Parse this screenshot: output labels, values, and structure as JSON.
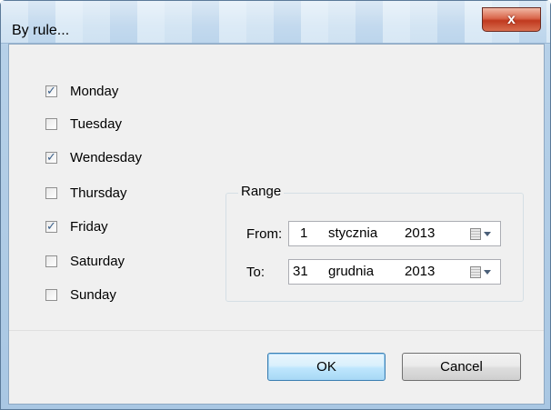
{
  "window": {
    "title": "By rule...",
    "close_glyph": "x"
  },
  "days": [
    {
      "label": "Monday",
      "checked": true
    },
    {
      "label": "Tuesday",
      "checked": false
    },
    {
      "label": "Wendesday",
      "checked": true
    },
    {
      "label": "Thursday",
      "checked": false
    },
    {
      "label": "Friday",
      "checked": true
    },
    {
      "label": "Saturday",
      "checked": false
    },
    {
      "label": "Sunday",
      "checked": false
    }
  ],
  "range": {
    "legend": "Range",
    "from": {
      "label": "From:",
      "day": "1",
      "month": "stycznia",
      "year": "2013"
    },
    "to": {
      "label": "To:",
      "day": "31",
      "month": "grudnia",
      "year": "2013"
    }
  },
  "buttons": {
    "ok": "OK",
    "cancel": "Cancel"
  },
  "icons": {
    "close": "close-icon",
    "check": "check-icon",
    "calendar": "calendar-icon",
    "dropdown": "chevron-down-icon"
  },
  "colors": {
    "close_button": "#c0391f",
    "default_button_border": "#3c7fb1",
    "check_mark": "#3a5f8a"
  }
}
